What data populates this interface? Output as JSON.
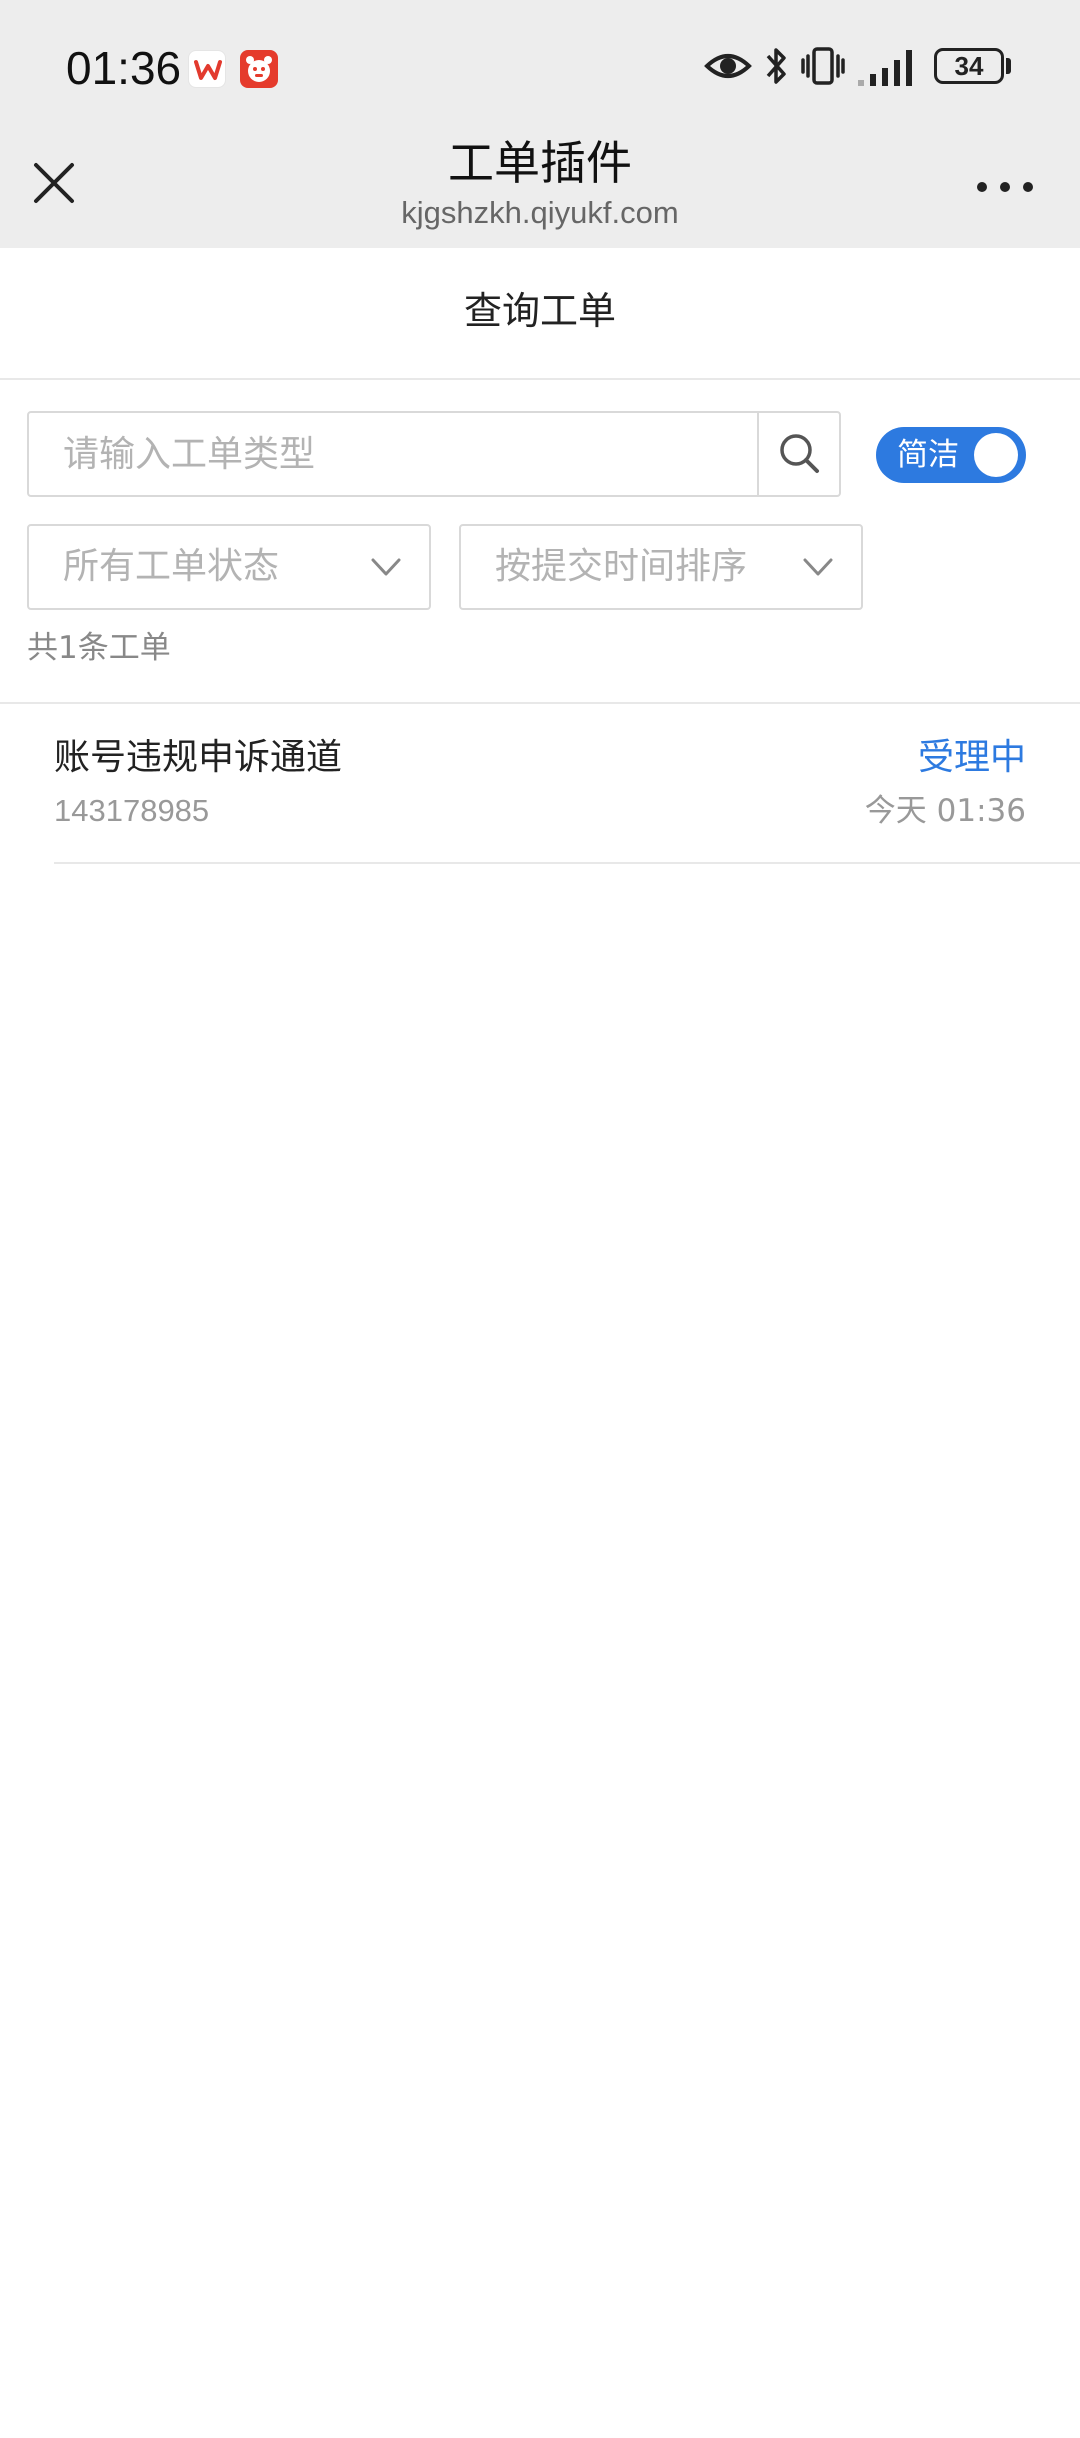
{
  "status_bar": {
    "time": "01:36",
    "battery": "34",
    "icons": [
      "wps-icon",
      "tiger-app-icon",
      "eye-icon",
      "bluetooth-icon",
      "vibrate-icon",
      "signal-icon",
      "battery-icon"
    ]
  },
  "header": {
    "title": "工单插件",
    "url": "kjgshzkh.qiyukf.com",
    "close_icon": "close-icon",
    "more_icon": "more-icon"
  },
  "page": {
    "title": "查询工单"
  },
  "search": {
    "placeholder": "请输入工单类型",
    "value": "",
    "icon": "search-icon"
  },
  "toggle": {
    "label": "简洁",
    "on": true,
    "color": "#2d7ae0"
  },
  "filters": {
    "status": "所有工单状态",
    "sort": "按提交时间排序"
  },
  "count_text": "共1条工单",
  "tickets": [
    {
      "title": "账号违规申诉通道",
      "id": "143178985",
      "status": "受理中",
      "time": "今天 01:36"
    }
  ],
  "colors": {
    "accent": "#2d7ae0",
    "header_bg": "#ededed"
  }
}
